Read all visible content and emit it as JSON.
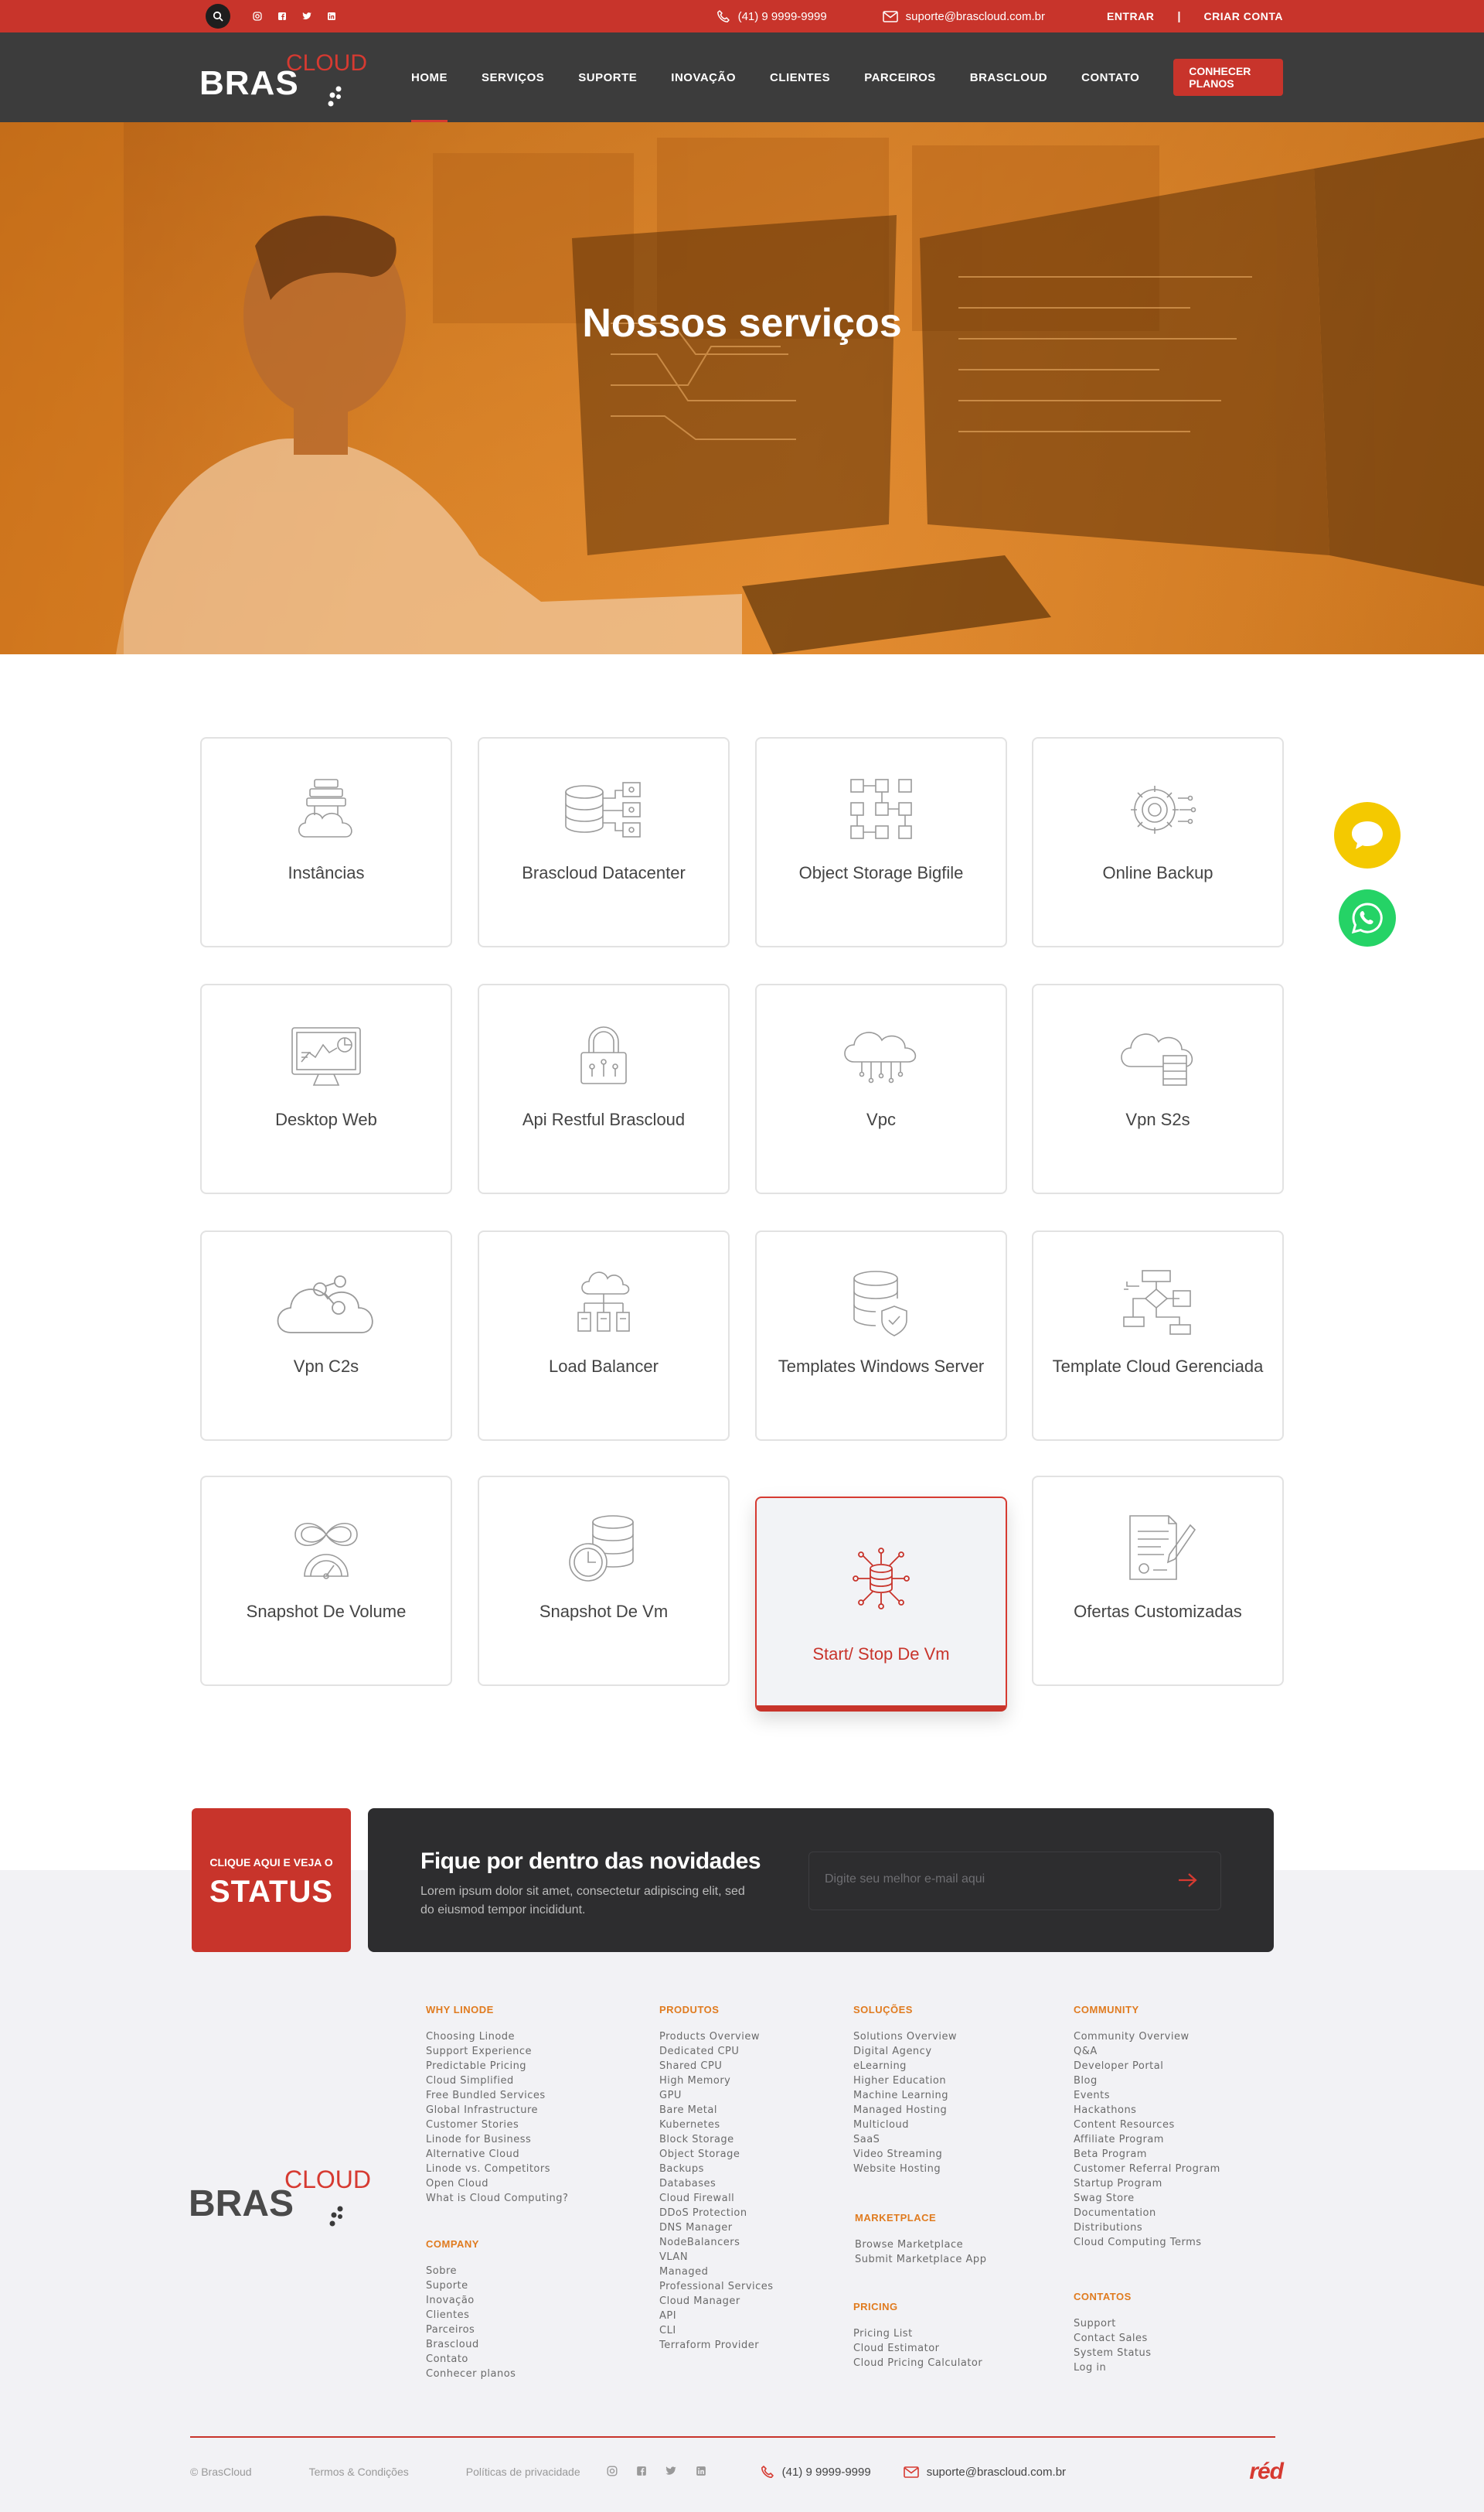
{
  "topbar": {
    "phone": "(41) 9 9999-9999",
    "email": "suporte@brascloud.com.br",
    "login": "ENTRAR",
    "separator": "|",
    "signup": "CRIAR CONTA",
    "social_icons": [
      "instagram-icon",
      "facebook-icon",
      "twitter-icon",
      "linkedin-icon"
    ]
  },
  "logo": {
    "bras": "BRAS",
    "cloud": "CLOUD"
  },
  "nav": {
    "items": [
      "HOME",
      "SERVIÇOS",
      "SUPORTE",
      "INOVAÇÃO",
      "CLIENTES",
      "PARCEIROS",
      "BRASCLOUD",
      "CONTATO"
    ],
    "active": "HOME",
    "cta": "CONHECER PLANOS"
  },
  "hero": {
    "title": "Nossos serviços"
  },
  "services": [
    {
      "label": "Instâncias",
      "icon": "cloud-server-icon"
    },
    {
      "label": "Brascloud Datacenter",
      "icon": "datacenter-icon"
    },
    {
      "label": "Object Storage Bigfile",
      "icon": "object-storage-icon"
    },
    {
      "label": "Online Backup",
      "icon": "gear-backup-icon"
    },
    {
      "label": "Desktop Web",
      "icon": "desktop-monitor-icon"
    },
    {
      "label": "Api Restful Brascloud",
      "icon": "api-lock-icon"
    },
    {
      "label": "Vpc",
      "icon": "cloud-network-icon"
    },
    {
      "label": "Vpn S2s",
      "icon": "cloud-vpn-icon"
    },
    {
      "label": "Vpn C2s",
      "icon": "cloud-share-icon"
    },
    {
      "label": "Load Balancer",
      "icon": "load-balancer-icon"
    },
    {
      "label": "Templates Windows Server",
      "icon": "database-shield-icon"
    },
    {
      "label": "Template Cloud Gerenciada",
      "icon": "flowchart-icon"
    },
    {
      "label": "Snapshot De Volume",
      "icon": "infinity-gauge-icon"
    },
    {
      "label": "Snapshot De Vm",
      "icon": "database-clock-icon"
    },
    {
      "label": "Start/ Stop De Vm",
      "icon": "database-network-icon",
      "active": true
    },
    {
      "label": "Ofertas Customizadas",
      "icon": "document-pen-icon"
    }
  ],
  "status": {
    "small": "CLIQUE AQUI E VEJA O",
    "big": "STATUS"
  },
  "newsletter": {
    "title": "Fique por dentro das novidades",
    "text": "Lorem ipsum dolor sit amet, consectetur adipiscing elit, sed do eiusmod tempor incididunt.",
    "placeholder": "Digite seu melhor e-mail aqui"
  },
  "footer": {
    "why": {
      "title": "WHY LINODE",
      "links": [
        "Choosing Linode",
        "Support Experience",
        "Predictable Pricing",
        "Cloud Simplified",
        "Free Bundled Services",
        "Global Infrastructure",
        "Customer Stories",
        "Linode for Business",
        "Alternative Cloud",
        "Linode vs. Competitors",
        "Open Cloud",
        "What is Cloud Computing?"
      ]
    },
    "company": {
      "title": "COMPANY",
      "links": [
        "Sobre",
        "Suporte",
        "Inovação",
        "Clientes",
        "Parceiros",
        "Brascloud",
        "Contato",
        "Conhecer planos"
      ]
    },
    "produtos": {
      "title": "PRODUTOS",
      "links": [
        "Products Overview",
        "Dedicated CPU",
        "Shared CPU",
        "High Memory",
        "GPU",
        "Bare Metal",
        "Kubernetes",
        "Block Storage",
        "Object Storage",
        "Backups",
        "Databases",
        "Cloud Firewall",
        "DDoS Protection",
        "DNS Manager",
        "NodeBalancers",
        "VLAN",
        "Managed",
        "Professional Services",
        "Cloud Manager",
        "API",
        "CLI",
        "Terraform Provider"
      ]
    },
    "solucoes": {
      "title": "SOLUÇÕES",
      "links": [
        "Solutions Overview",
        "Digital Agency",
        "eLearning",
        "Higher Education",
        "Machine Learning",
        "Managed Hosting",
        "Multicloud",
        "SaaS",
        "Video Streaming",
        "Website Hosting"
      ]
    },
    "marketplace": {
      "title": "MARKETPLACE",
      "links": [
        "Browse Marketplace",
        "Submit Marketplace App"
      ]
    },
    "pricing": {
      "title": "PRICING",
      "links": [
        "Pricing List",
        "Cloud Estimator",
        "Cloud Pricing Calculator"
      ]
    },
    "community": {
      "title": "COMMUNITY",
      "links": [
        "Community Overview",
        "Q&A",
        "Developer Portal",
        "Blog",
        "Events",
        "Hackathons",
        "Content Resources",
        "Affiliate Program",
        "Beta Program",
        "Customer Referral Program",
        "Startup Program",
        "Swag Store",
        "Documentation",
        "Distributions",
        "Cloud Computing Terms"
      ]
    },
    "contatos": {
      "title": "CONTATOS",
      "links": [
        "Support",
        "Contact Sales",
        "System Status",
        "Log in"
      ]
    }
  },
  "bottom": {
    "copyright": "© BrasCloud",
    "terms": "Termos & Condições",
    "privacy": "Políticas de privacidade",
    "phone": "(41) 9 9999-9999",
    "email": "suporte@brascloud.com.br",
    "brand": "réd"
  },
  "colors": {
    "accent": "#c8342b",
    "nav": "#3c3c3c",
    "hero": "#e58e32",
    "orange_heading": "#e07b1f"
  }
}
